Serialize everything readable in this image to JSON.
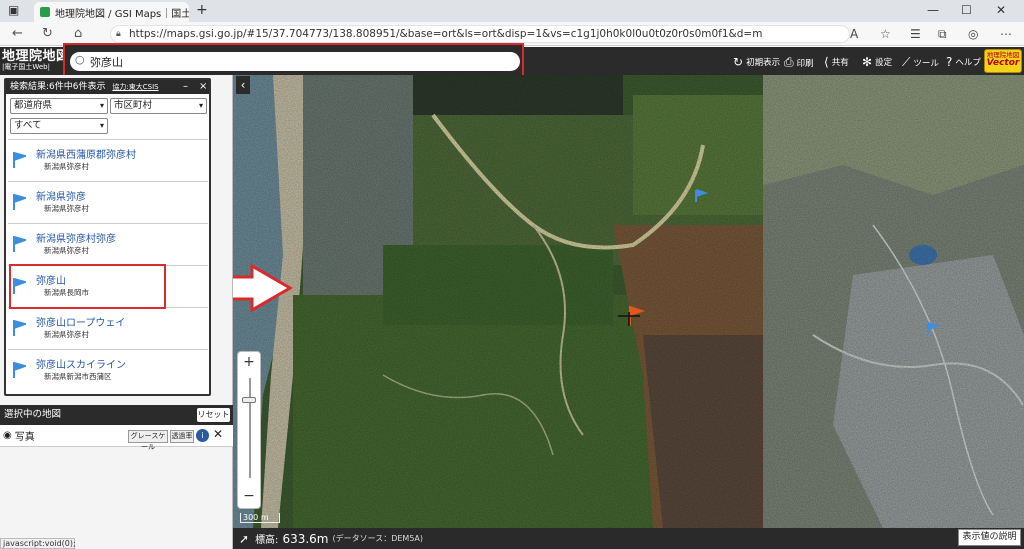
{
  "browser": {
    "tab_title": "地理院地図 / GSI Maps｜国土地",
    "url": "https://maps.gsi.go.jp/#15/37.704773/138.808951/&base=ort&ls=ort&disp=1&vs=c1g1j0h0k0l0u0t0z0r0s0m0f1&d=m",
    "tab_close": "✕",
    "new_tab": "+",
    "win_min": "—",
    "win_max": "☐",
    "win_close": "✕"
  },
  "app": {
    "logo_line1": "地理院地図",
    "logo_line2": "|電子国土Web|",
    "search_value": "弥彦山",
    "menu": {
      "initial": "初期表示",
      "print": "印刷",
      "share": "共有",
      "settings": "設定",
      "tools": "ツール",
      "help": "ヘルプ"
    },
    "badge_line1": "地理院地図",
    "badge_line2": "Vector"
  },
  "search_panel": {
    "header": "検索結果:6件中6件表示",
    "credit": "協力:東大CSIS",
    "prefecture_placeholder": "都道府県",
    "city_placeholder": "市区町村",
    "type_filter": "すべて",
    "results": [
      {
        "name": "新潟県西蒲原郡弥彦村",
        "sub": "新潟県弥彦村"
      },
      {
        "name": "新潟県弥彦",
        "sub": "新潟県弥彦村"
      },
      {
        "name": "新潟県弥彦村弥彦",
        "sub": "新潟県弥彦村"
      },
      {
        "name": "弥彦山",
        "sub": "新潟県長岡市"
      },
      {
        "name": "弥彦山ロープウェイ",
        "sub": "新潟県弥彦村"
      },
      {
        "name": "弥彦山スカイライン",
        "sub": "新潟県新潟市西蒲区"
      }
    ]
  },
  "selected_maps": {
    "title": "選択中の地図",
    "reset": "リセット",
    "layer_name": "写真",
    "grayscale": "グレースケール",
    "transparency": "透過率"
  },
  "map": {
    "scale_label": "300 m",
    "elevation_label": "標高:",
    "elevation_value": "633.6m",
    "data_source": "(データソース：DEM5A)",
    "display_button": "表示値の説明"
  },
  "statusbar": {
    "js": "javascript:void(0);"
  },
  "colors": {
    "highlight_red": "#d82b2b",
    "header_dark": "#2b2b2b",
    "link_blue": "#2357a8",
    "badge_yellow": "#f2d21a"
  }
}
